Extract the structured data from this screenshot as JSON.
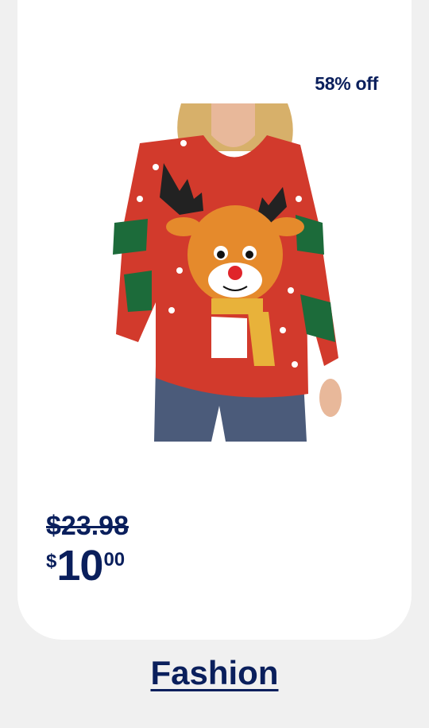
{
  "product": {
    "discount_badge": "58% off",
    "image_alt": "Red reindeer Christmas sweater",
    "old_price": "$23.98",
    "price": {
      "currency": "$",
      "dollars": "10",
      "cents": "00"
    }
  },
  "category": {
    "label": "Fashion"
  },
  "colors": {
    "brand": "#0a1f5c",
    "sweater_red": "#d23a2c",
    "sweater_green": "#1c6b3a"
  }
}
